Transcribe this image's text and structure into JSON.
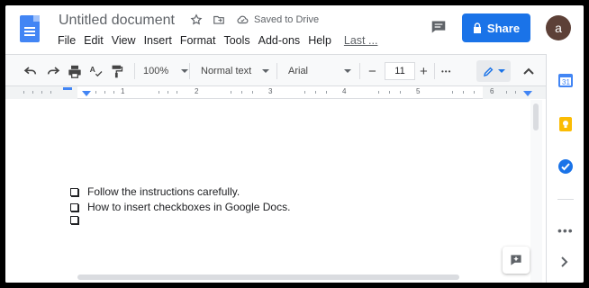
{
  "header": {
    "title": "Untitled document",
    "saved_status": "Saved to Drive",
    "share_label": "Share",
    "avatar_letter": "a"
  },
  "menu": {
    "items": [
      "File",
      "Edit",
      "View",
      "Insert",
      "Format",
      "Tools",
      "Add-ons",
      "Help"
    ],
    "last_edit": "Last ..."
  },
  "toolbar": {
    "zoom": "100%",
    "style": "Normal text",
    "font": "Arial",
    "font_size": "11",
    "minus": "−",
    "plus": "+",
    "more": "•••"
  },
  "ruler": {
    "numbers": [
      "1",
      "2",
      "3",
      "4",
      "5",
      "6"
    ]
  },
  "document": {
    "checklist": [
      "Follow the instructions carefully.",
      "How to insert checkboxes in Google Docs.",
      ""
    ]
  },
  "colors": {
    "accent": "#1a73e8",
    "doc_icon": "#4285f4",
    "avatar": "#5d4037"
  }
}
